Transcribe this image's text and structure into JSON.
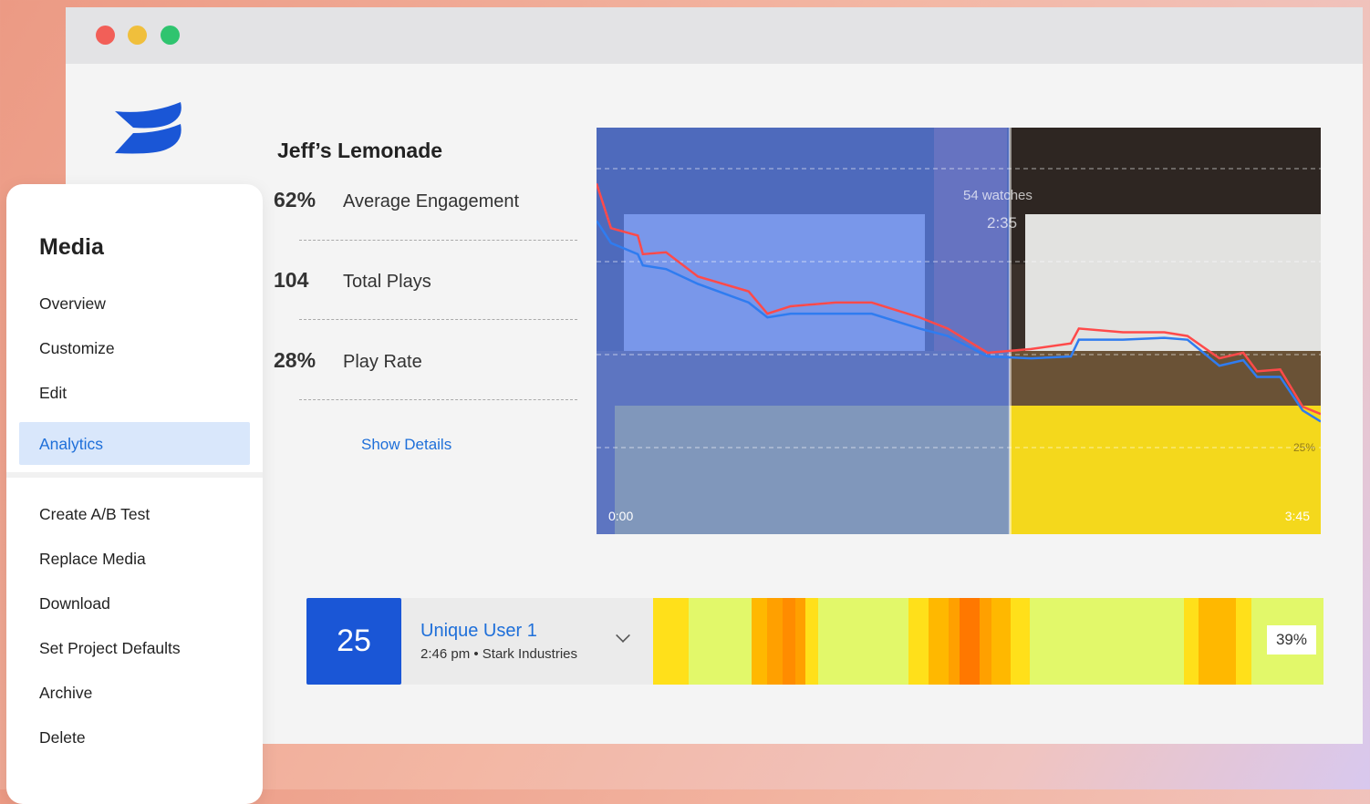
{
  "window": {
    "controls": [
      {
        "name": "close",
        "color": "#f25f58"
      },
      {
        "name": "minimize",
        "color": "#f0bf3c"
      },
      {
        "name": "maximize",
        "color": "#2fc46f"
      }
    ]
  },
  "brand": {
    "logo": "wistia-logo",
    "color": "#1a56d6"
  },
  "media": {
    "title": "Jeff’s Lemonade",
    "stats": [
      {
        "value": "62%",
        "label": "Average Engagement"
      },
      {
        "value": "104",
        "label": "Total Plays"
      },
      {
        "value": "28%",
        "label": "Play Rate"
      }
    ],
    "show_details": "Show Details"
  },
  "sidebar": {
    "title": "Media",
    "items": [
      {
        "label": "Overview"
      },
      {
        "label": "Customize"
      },
      {
        "label": "Edit"
      },
      {
        "label": "Analytics",
        "active": true
      },
      {
        "label": "Create A/B Test"
      },
      {
        "label": "Replace Media"
      },
      {
        "label": "Download"
      },
      {
        "label": "Set Project Defaults"
      },
      {
        "label": "Archive"
      },
      {
        "label": "Delete"
      }
    ]
  },
  "chart_data": {
    "type": "line",
    "x_start_label": "0:00",
    "x_end_label": "3:45",
    "ylim": [
      0,
      100
    ],
    "grid_values": [
      25,
      50,
      75,
      100
    ],
    "grid_label": "25%",
    "hover": {
      "time_label": "2:35",
      "watches_label": "54 watches",
      "position_fraction": 0.571
    },
    "series": [
      {
        "color": "#ff4a4a",
        "points": [
          [
            0,
            96
          ],
          [
            0.02,
            84
          ],
          [
            0.057,
            82
          ],
          [
            0.064,
            77
          ],
          [
            0.096,
            77.5
          ],
          [
            0.14,
            71
          ],
          [
            0.21,
            67
          ],
          [
            0.236,
            61
          ],
          [
            0.268,
            63
          ],
          [
            0.33,
            64
          ],
          [
            0.38,
            64
          ],
          [
            0.446,
            60
          ],
          [
            0.485,
            57
          ],
          [
            0.54,
            50.5
          ],
          [
            0.6,
            51.5
          ],
          [
            0.655,
            53
          ],
          [
            0.666,
            57
          ],
          [
            0.727,
            56
          ],
          [
            0.784,
            56
          ],
          [
            0.816,
            55
          ],
          [
            0.86,
            49
          ],
          [
            0.893,
            50.5
          ],
          [
            0.912,
            45.5
          ],
          [
            0.944,
            46
          ],
          [
            0.975,
            36
          ],
          [
            1,
            34
          ]
        ]
      },
      {
        "color": "#2f7cf0",
        "points": [
          [
            0,
            86
          ],
          [
            0.02,
            80
          ],
          [
            0.057,
            77
          ],
          [
            0.064,
            74
          ],
          [
            0.096,
            73
          ],
          [
            0.14,
            69
          ],
          [
            0.21,
            64
          ],
          [
            0.236,
            60
          ],
          [
            0.268,
            61
          ],
          [
            0.33,
            61
          ],
          [
            0.38,
            61
          ],
          [
            0.446,
            57
          ],
          [
            0.485,
            55
          ],
          [
            0.54,
            49.5
          ],
          [
            0.6,
            49
          ],
          [
            0.655,
            49.5
          ],
          [
            0.666,
            54
          ],
          [
            0.727,
            54
          ],
          [
            0.784,
            54.5
          ],
          [
            0.816,
            54
          ],
          [
            0.86,
            47
          ],
          [
            0.893,
            48.5
          ],
          [
            0.912,
            44
          ],
          [
            0.944,
            44
          ],
          [
            0.975,
            35
          ],
          [
            1,
            32
          ]
        ]
      }
    ]
  },
  "viewer": {
    "count": "25",
    "name": "Unique User 1",
    "meta": "2:46 pm • Stark Industries",
    "percent": "39%",
    "heatmap": [
      {
        "from": 0,
        "to": 0.052,
        "color": "#ffe01a"
      },
      {
        "from": 0.052,
        "to": 0.146,
        "color": "#e2f86a"
      },
      {
        "from": 0.146,
        "to": 0.17,
        "color": "#ffb800"
      },
      {
        "from": 0.17,
        "to": 0.192,
        "color": "#ffa000"
      },
      {
        "from": 0.192,
        "to": 0.211,
        "color": "#ff8c00"
      },
      {
        "from": 0.211,
        "to": 0.226,
        "color": "#ffa000"
      },
      {
        "from": 0.226,
        "to": 0.245,
        "color": "#ffe01a"
      },
      {
        "from": 0.245,
        "to": 0.38,
        "color": "#e2f86a"
      },
      {
        "from": 0.38,
        "to": 0.41,
        "color": "#ffe01a"
      },
      {
        "from": 0.41,
        "to": 0.44,
        "color": "#ffb800"
      },
      {
        "from": 0.44,
        "to": 0.456,
        "color": "#ffa000"
      },
      {
        "from": 0.456,
        "to": 0.487,
        "color": "#ff7800"
      },
      {
        "from": 0.487,
        "to": 0.504,
        "color": "#ffa000"
      },
      {
        "from": 0.504,
        "to": 0.532,
        "color": "#ffb800"
      },
      {
        "from": 0.532,
        "to": 0.561,
        "color": "#ffe01a"
      },
      {
        "from": 0.561,
        "to": 0.791,
        "color": "#e2f86a"
      },
      {
        "from": 0.791,
        "to": 0.813,
        "color": "#ffe01a"
      },
      {
        "from": 0.813,
        "to": 0.869,
        "color": "#ffb800"
      },
      {
        "from": 0.869,
        "to": 0.892,
        "color": "#ffe01a"
      },
      {
        "from": 0.892,
        "to": 1,
        "color": "#e2f86a"
      }
    ]
  }
}
